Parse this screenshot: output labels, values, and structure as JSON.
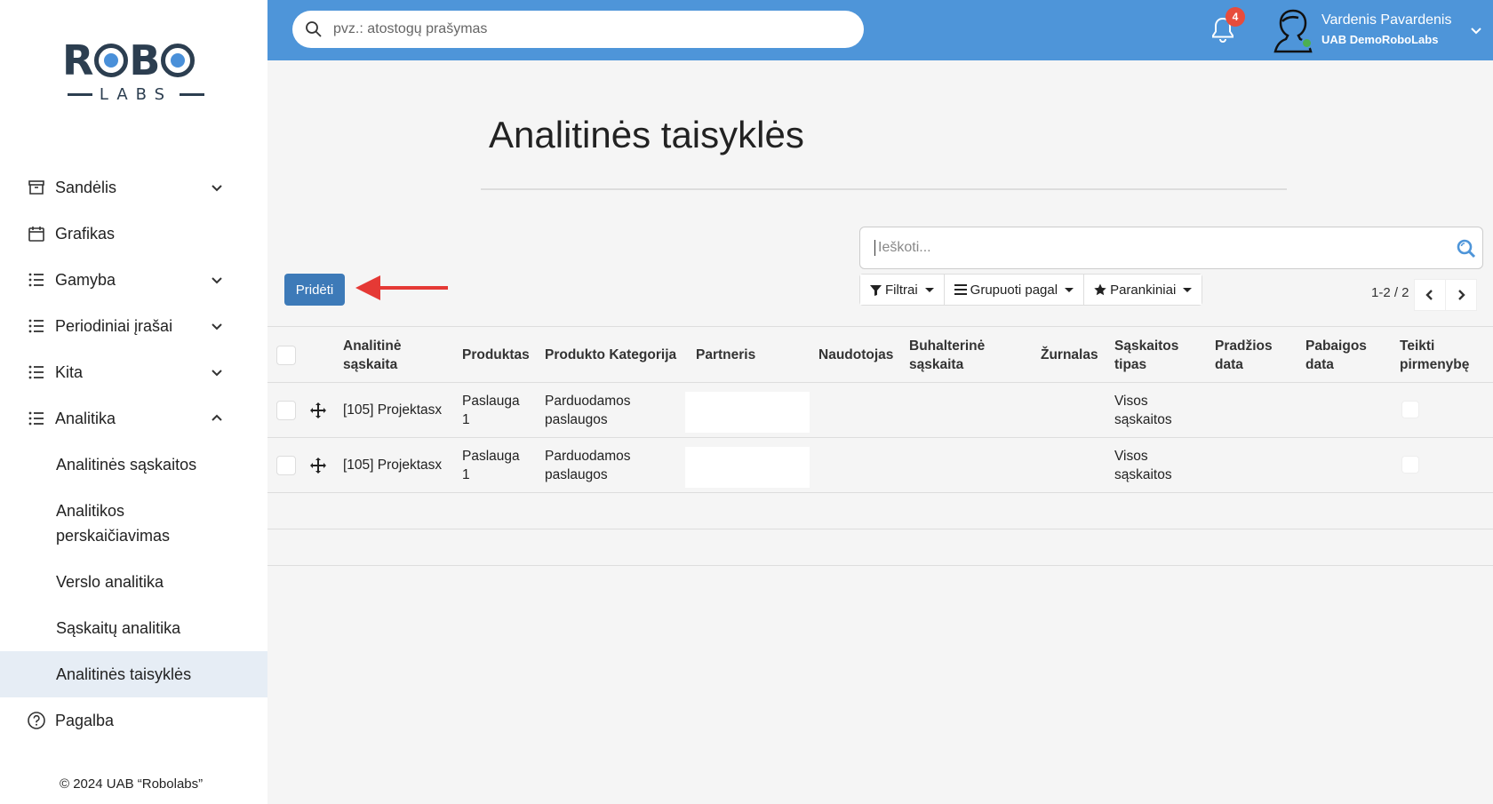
{
  "brand": {
    "logo_top": "ROBO",
    "logo_bottom": "LABS"
  },
  "sidebar": {
    "items": [
      {
        "label": "Sandėlis",
        "icon": "archive-icon",
        "expandable": true
      },
      {
        "label": "Grafikas",
        "icon": "calendar-icon",
        "expandable": false
      },
      {
        "label": "Gamyba",
        "icon": "list-icon",
        "expandable": true
      },
      {
        "label": "Periodiniai įrašai",
        "icon": "list-icon",
        "expandable": true
      },
      {
        "label": "Kita",
        "icon": "list-icon",
        "expandable": true
      },
      {
        "label": "Analitika",
        "icon": "list-icon",
        "expandable": true,
        "expanded": true
      }
    ],
    "subitems": [
      {
        "label": "Analitinės sąskaitos"
      },
      {
        "label": "Analitikos perskaičiavimas"
      },
      {
        "label": "Verslo analitika"
      },
      {
        "label": "Sąskaitų analitika"
      },
      {
        "label": "Analitinės taisyklės",
        "active": true
      }
    ],
    "help": {
      "label": "Pagalba",
      "icon": "question-circle-icon"
    },
    "copyright": "© 2024 UAB “Robolabs”"
  },
  "topbar": {
    "search_placeholder": "pvz.: atostogų prašymas",
    "notifications_count": "4",
    "user_name": "Vardenis Pavardenis",
    "user_company": "UAB DemoRoboLabs",
    "accent": "#4e95d9"
  },
  "page": {
    "title": "Analitinės taisyklės",
    "search_placeholder": "Ieškoti...",
    "add_label": "Pridėti",
    "filters_label": "Filtrai",
    "group_label": "Grupuoti pagal",
    "favorites_label": "Parankiniai",
    "pager": "1-2 / 2"
  },
  "table": {
    "headers": {
      "analytic_account": "Analitinė sąskaita",
      "product": "Produktas",
      "product_category": "Produkto Kategorija",
      "partner": "Partneris",
      "user": "Naudotojas",
      "accounting_account": "Buhalterinė sąskaita",
      "journal": "Žurnalas",
      "invoice_type": "Sąskaitos tipas",
      "start_date": "Pradžios data",
      "end_date": "Pabaigos data",
      "priority": "Teikti pirmenybę"
    },
    "rows": [
      {
        "analytic_account": "[105] Projektasx",
        "product": "Paslauga 1",
        "product_category": "Parduodamos paslaugos",
        "invoice_type": "Visos sąskaitos"
      },
      {
        "analytic_account": "[105] Projektasx",
        "product": "Paslauga 1",
        "product_category": "Parduodamos paslaugos",
        "invoice_type": "Visos sąskaitos"
      }
    ]
  }
}
